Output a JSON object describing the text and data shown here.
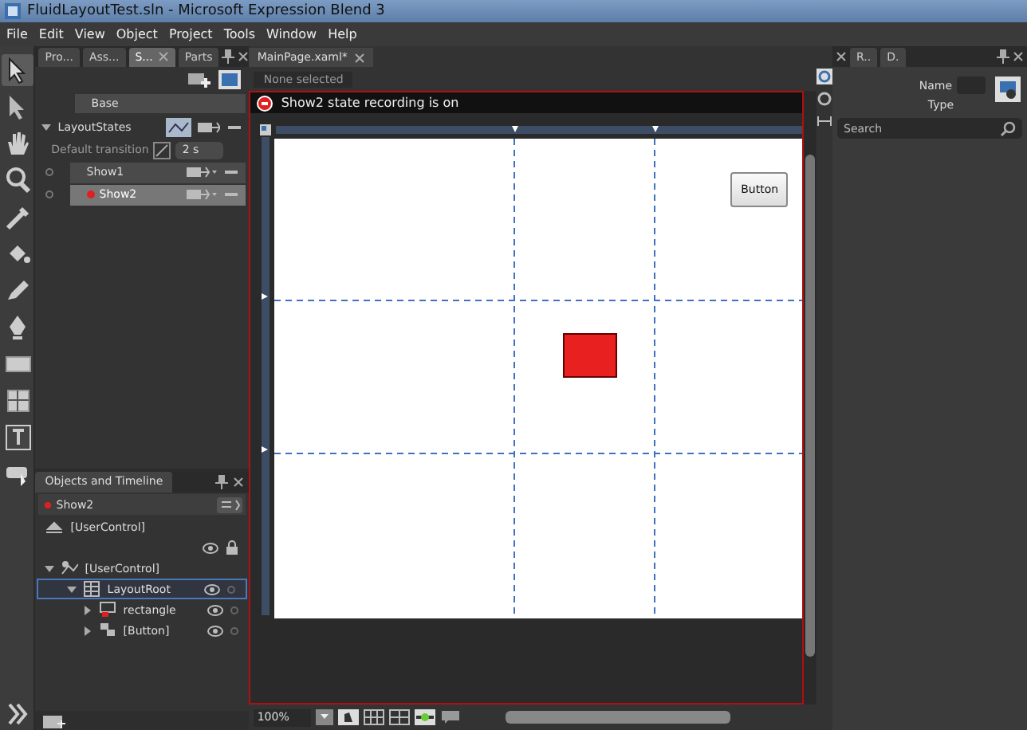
{
  "window": {
    "title": "FluidLayoutTest.sln - Microsoft Expression Blend 3"
  },
  "menu": [
    "File",
    "Edit",
    "View",
    "Object",
    "Project",
    "Tools",
    "Window",
    "Help"
  ],
  "left_tabs": [
    {
      "label": "Pro...",
      "selected": false
    },
    {
      "label": "Ass...",
      "selected": false
    },
    {
      "label": "S...",
      "selected": true
    },
    {
      "label": "Parts",
      "selected": false
    }
  ],
  "states": {
    "base": "Base",
    "groups": [
      {
        "name": "LayoutStates",
        "transition_label": "Default transition",
        "transition_value": "2 s",
        "states": [
          {
            "name": "Show1",
            "selected": false,
            "recording": false
          },
          {
            "name": "Show2",
            "selected": true,
            "recording": true
          }
        ]
      }
    ]
  },
  "objects": {
    "title": "Objects and Timeline",
    "timeline": "Show2",
    "root": "[UserControl]",
    "tree": [
      {
        "label": "[UserControl]",
        "kind": "control",
        "expanded": true,
        "selected": false,
        "children": [
          {
            "label": "LayoutRoot",
            "kind": "grid",
            "expanded": true,
            "selected": true,
            "children": [
              {
                "label": "rectangle",
                "kind": "rectangle",
                "expanded": false,
                "selected": false
              },
              {
                "label": "[Button]",
                "kind": "button",
                "expanded": false,
                "selected": false
              }
            ]
          }
        ]
      }
    ]
  },
  "document": {
    "tab": "MainPage.xaml*",
    "selection": "None selected",
    "recording": "Show2 state recording is on",
    "button": "Button",
    "zoom": "100%"
  },
  "right_panel": {
    "tabs": [
      {
        "label": "R..",
        "selected": false
      },
      {
        "label": "D.",
        "selected": false
      }
    ],
    "name_label": "Name",
    "type_label": "Type",
    "search": {
      "placeholder": "Search"
    }
  }
}
